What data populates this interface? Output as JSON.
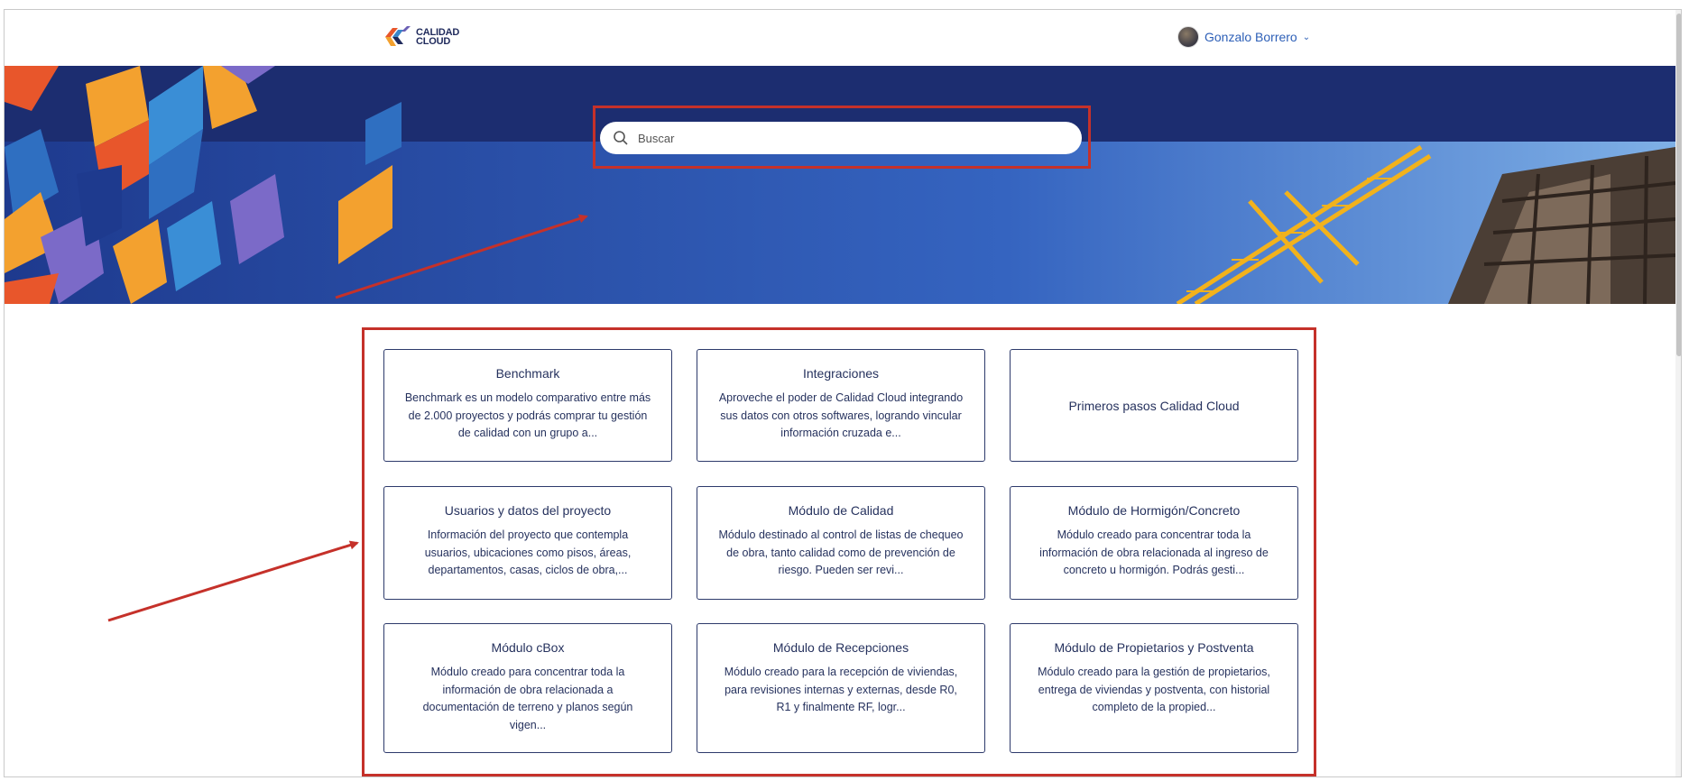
{
  "brand": {
    "line1": "CALIDAD",
    "line2": "CLOUD"
  },
  "user": {
    "name": "Gonzalo Borrero"
  },
  "search": {
    "placeholder": "Buscar"
  },
  "colors": {
    "hero": "#1c2d70",
    "annotation": "#c5312a",
    "link": "#2d5fb7"
  },
  "cards": [
    {
      "title": "Benchmark",
      "desc": "Benchmark es un modelo comparativo entre más de 2.000 proyectos y podrás comprar tu gestión de calidad con un grupo a..."
    },
    {
      "title": "Integraciones",
      "desc": "Aproveche el poder de Calidad Cloud integrando sus datos con otros softwares, logrando vincular información cruzada e..."
    },
    {
      "title": "Primeros pasos Calidad Cloud",
      "desc": ""
    },
    {
      "title": "Usuarios y datos del proyecto",
      "desc": "Información del proyecto que contempla usuarios, ubicaciones como pisos, áreas, departamentos, casas, ciclos de obra,..."
    },
    {
      "title": "Módulo de Calidad",
      "desc": "Módulo destinado al control de listas de chequeo de obra, tanto calidad como de prevención de riesgo. Pueden ser revi..."
    },
    {
      "title": "Módulo de Hormigón/Concreto",
      "desc": "Módulo creado para concentrar toda la información de obra relacionada al ingreso de concreto u hormigón. Podrás gesti..."
    },
    {
      "title": "Módulo cBox",
      "desc": "Módulo creado para concentrar toda la información de obra relacionada a documentación de terreno y planos según vigen..."
    },
    {
      "title": "Módulo de Recepciones",
      "desc": "Módulo creado para la recepción de viviendas, para revisiones internas y externas, desde R0, R1 y finalmente RF, logr..."
    },
    {
      "title": "Módulo de Propietarios y Postventa",
      "desc": "Módulo creado para la gestión de propietarios, entrega de viviendas y postventa, con historial completo de la propied..."
    }
  ]
}
